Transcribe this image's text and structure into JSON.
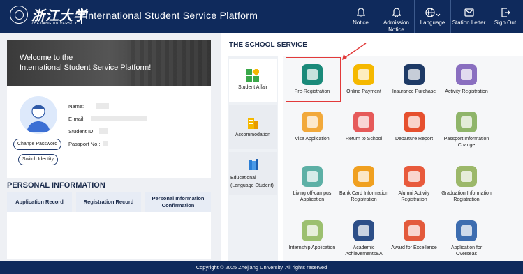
{
  "header": {
    "logo_cn": "浙江大学",
    "logo_en": "ZHEJIANG UNIVERSITY",
    "title": "International Student Service Platform",
    "nav": [
      {
        "label": "Notice",
        "icon": "bell-icon"
      },
      {
        "label": "Admission Notice",
        "icon": "bell-icon"
      },
      {
        "label": "Language",
        "icon": "globe-icon"
      },
      {
        "label": "Station Letter",
        "icon": "mail-icon"
      },
      {
        "label": "Sign Out",
        "icon": "sign-out-icon"
      }
    ]
  },
  "welcome": {
    "line1": "Welcome to the",
    "line2": "International Student Service Platform!"
  },
  "profile": {
    "name_label": "Name:",
    "email_label": "E-mail:",
    "student_id_label": "Student ID:",
    "passport_label": "Passport No.:",
    "change_password": "Change Password",
    "switch_identity": "Switch Identity"
  },
  "personal_info": {
    "title": "PERSONAL INFORMATION",
    "buttons": [
      "Application Record",
      "Registration Record",
      "Personal Information Confirmation"
    ]
  },
  "school_service": {
    "title": "THE SCHOOL SERVICE",
    "categories": [
      "Student Affair",
      "Accommodation",
      "Educational (Language Student)"
    ],
    "services": [
      {
        "label": "Pre-Registration",
        "color": "#1a8a7a"
      },
      {
        "label": "Online Payment",
        "color": "#f5b800"
      },
      {
        "label": "Insurance Purchase",
        "color": "#1e3a66"
      },
      {
        "label": "Activity Registration",
        "color": "#8a6fc0"
      },
      {
        "label": "Visa Application",
        "color": "#f2a93b"
      },
      {
        "label": "Return to School",
        "color": "#e65a5a"
      },
      {
        "label": "Departure Report",
        "color": "#e6502e"
      },
      {
        "label": "Passport Information Change",
        "color": "#8fb56a"
      },
      {
        "label": "Living off-campus Application",
        "color": "#5db0a6"
      },
      {
        "label": "Bank Card Information Registration",
        "color": "#f0a020"
      },
      {
        "label": "Alumni Activity Registration",
        "color": "#e85a3c"
      },
      {
        "label": "Graduation Information Registration",
        "color": "#9cb86a"
      },
      {
        "label": "Internship Application",
        "color": "#9cc070"
      },
      {
        "label": "Academic Achievements&A",
        "color": "#2d4f88"
      },
      {
        "label": "Award for Excellence",
        "color": "#e35a3c"
      },
      {
        "label": "Application for Overseas",
        "color": "#3d6db0"
      }
    ]
  },
  "footer": {
    "copyright": "Copyright © 2025 Zhejiang University. All rights reserved"
  },
  "colors": {
    "brand": "#0f2a5c",
    "highlight": "#e23a3a"
  }
}
